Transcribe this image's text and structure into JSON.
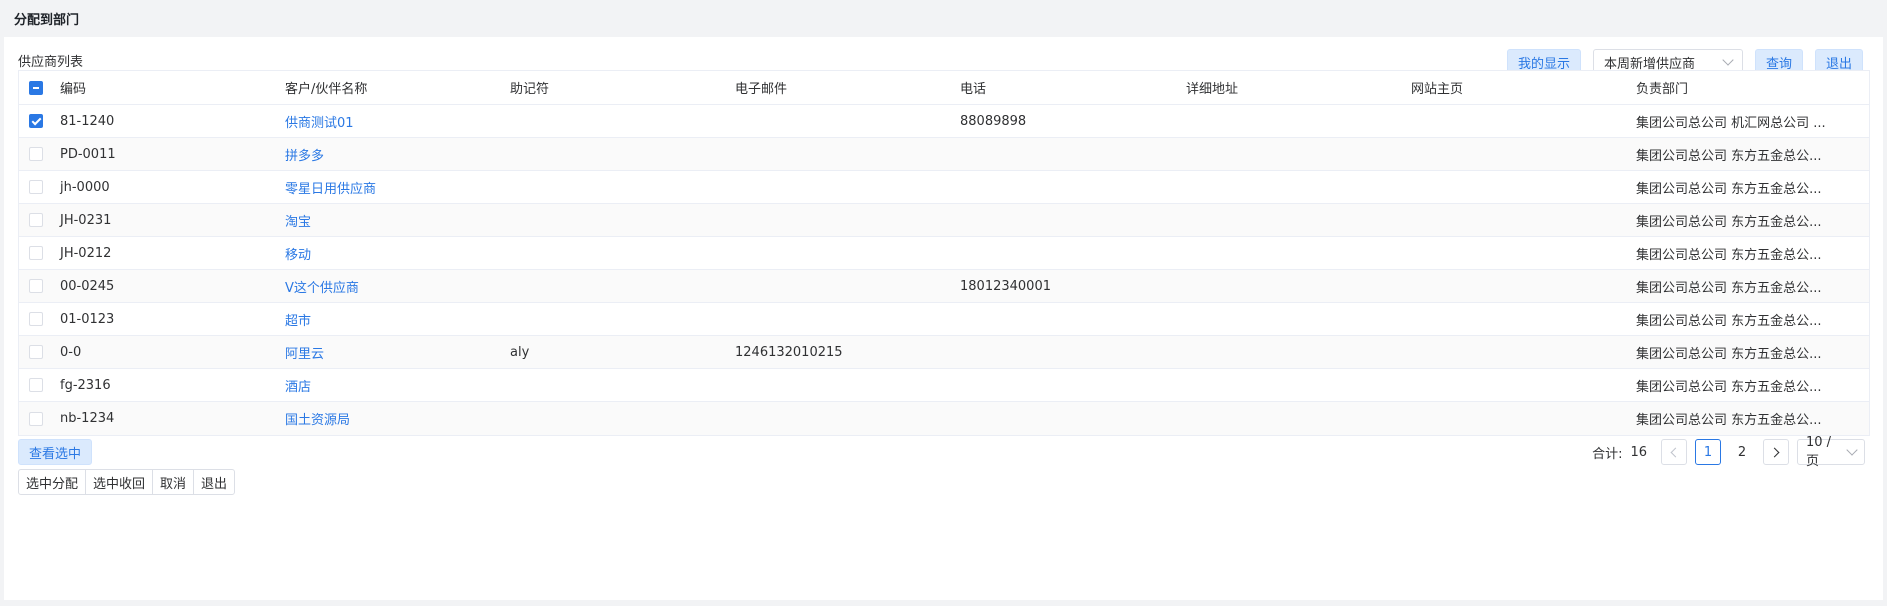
{
  "page": {
    "title": "分配到部门"
  },
  "panel": {
    "title": "供应商列表"
  },
  "toolbar": {
    "my_display": "我的显示",
    "filter_value": "本周新增供应商",
    "query": "查询",
    "exit": "退出"
  },
  "table": {
    "headers": [
      "编码",
      "客户/伙伴名称",
      "助记符",
      "电子邮件",
      "电话",
      "详细地址",
      "网站主页",
      "负责部门"
    ],
    "rows": [
      {
        "checked": true,
        "code": "81-1240",
        "name": "供商测试01",
        "memo": "",
        "email": "",
        "phone": "88089898",
        "address": "",
        "website": "",
        "dept": "集团公司总公司 机汇网总公司 ..."
      },
      {
        "checked": false,
        "code": "PD-0011",
        "name": "拼多多",
        "memo": "",
        "email": "",
        "phone": "",
        "address": "",
        "website": "",
        "dept": "集团公司总公司 东方五金总公..."
      },
      {
        "checked": false,
        "code": "jh-0000",
        "name": "零星日用供应商",
        "memo": "",
        "email": "",
        "phone": "",
        "address": "",
        "website": "",
        "dept": "集团公司总公司 东方五金总公..."
      },
      {
        "checked": false,
        "code": "JH-0231",
        "name": "淘宝",
        "memo": "",
        "email": "",
        "phone": "",
        "address": "",
        "website": "",
        "dept": "集团公司总公司 东方五金总公..."
      },
      {
        "checked": false,
        "code": "JH-0212",
        "name": "移动",
        "memo": "",
        "email": "",
        "phone": "",
        "address": "",
        "website": "",
        "dept": "集团公司总公司 东方五金总公..."
      },
      {
        "checked": false,
        "code": "00-0245",
        "name": "V这个供应商",
        "memo": "",
        "email": "",
        "phone": "18012340001",
        "address": "",
        "website": "",
        "dept": "集团公司总公司 东方五金总公..."
      },
      {
        "checked": false,
        "code": "01-0123",
        "name": "超市",
        "memo": "",
        "email": "",
        "phone": "",
        "address": "",
        "website": "",
        "dept": "集团公司总公司 东方五金总公..."
      },
      {
        "checked": false,
        "code": "0-0",
        "name": "阿里云",
        "memo": "aly",
        "email": "1246132010215",
        "phone": "",
        "address": "",
        "website": "",
        "dept": "集团公司总公司 东方五金总公..."
      },
      {
        "checked": false,
        "code": "fg-2316",
        "name": "酒店",
        "memo": "",
        "email": "",
        "phone": "",
        "address": "",
        "website": "",
        "dept": "集团公司总公司 东方五金总公..."
      },
      {
        "checked": false,
        "code": "nb-1234",
        "name": "国土资源局",
        "memo": "",
        "email": "",
        "phone": "",
        "address": "",
        "website": "",
        "dept": "集团公司总公司 东方五金总公..."
      }
    ]
  },
  "footer": {
    "view_selected": "查看选中",
    "total_label": "合计:",
    "total": "16",
    "pages": [
      "1",
      "2"
    ],
    "current_page": "1",
    "page_size": "10 / 页"
  },
  "actions": [
    "选中分配",
    "选中收回",
    "取消",
    "退出"
  ],
  "colors": {
    "accent": "#2a78e4",
    "light_button_bg": "#dbeafd",
    "stripe": "#fafafa"
  }
}
